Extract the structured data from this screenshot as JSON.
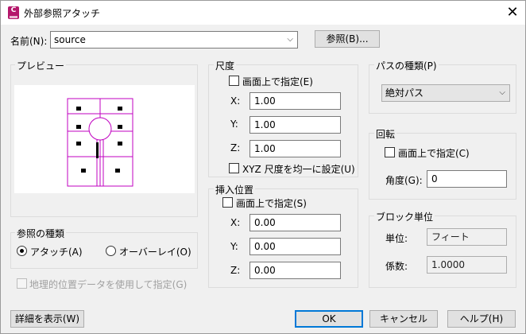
{
  "window": {
    "title": "外部参照アタッチ",
    "close_glyph": "✕",
    "app_icon_letter": "C"
  },
  "name_row": {
    "label": "名前(N):",
    "value": "source",
    "browse_label": "参照(B)..."
  },
  "preview": {
    "title": "プレビュー"
  },
  "scale": {
    "title": "尺度",
    "on_screen_label": "画面上で指定(E)",
    "x_label": "X:",
    "x_value": "1.00",
    "y_label": "Y:",
    "y_value": "1.00",
    "z_label": "Z:",
    "z_value": "1.00",
    "uniform_label": "XYZ 尺度を均一に設定(U)"
  },
  "insertion": {
    "title": "挿入位置",
    "on_screen_label": "画面上で指定(S)",
    "x_label": "X:",
    "x_value": "0.00",
    "y_label": "Y:",
    "y_value": "0.00",
    "z_label": "Z:",
    "z_value": "0.00"
  },
  "path_type": {
    "title": "パスの種類(P)",
    "selected": "絶対パス"
  },
  "rotation": {
    "title": "回転",
    "on_screen_label": "画面上で指定(C)",
    "angle_label": "角度(G):",
    "angle_value": "0"
  },
  "block_unit": {
    "title": "ブロック単位",
    "unit_label": "単位:",
    "unit_value": "フィート",
    "factor_label": "係数:",
    "factor_value": "1.0000"
  },
  "reference_type": {
    "title": "参照の種類",
    "attach_label": "アタッチ(A)",
    "overlay_label": "オーバーレイ(O)",
    "selected": "attach"
  },
  "geo_label": "地理的位置データを使用して指定(G)",
  "footer": {
    "details_label": "詳細を表示(W)",
    "ok_label": "OK",
    "cancel_label": "キャンセル",
    "help_label": "ヘルプ(H)"
  },
  "colors": {
    "preview_lines": "#c000c0",
    "app_icon": "#b5176b",
    "focus": "#0078d7"
  }
}
